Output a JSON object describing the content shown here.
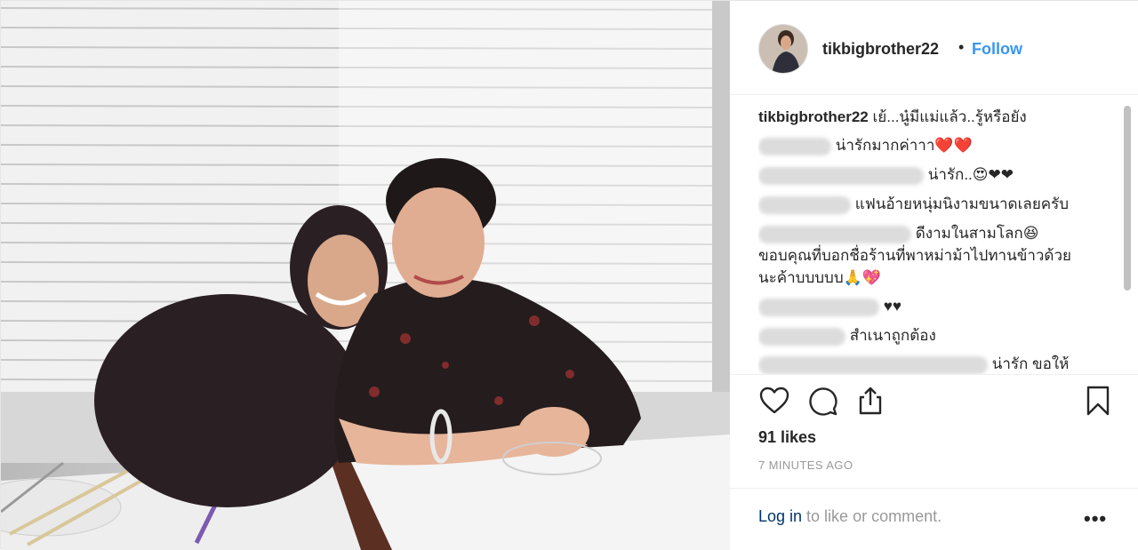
{
  "post": {
    "username": "tikbigbrother22",
    "separator": "•",
    "follow_label": "Follow",
    "caption": {
      "username": "tikbigbrother22",
      "text": "เย้...นู๋มีแม่แล้ว..รู้หรือยัง"
    },
    "comments": [
      {
        "text": "น่ารักมากค่าาา❤️❤️"
      },
      {
        "text": "น่ารัก..😍❤❤"
      },
      {
        "text": "แฟนอ้ายหนุ่มนิงามขนาดเลยครับ"
      },
      {
        "text": "ดีงามในสามโลก😆",
        "line2": "ขอบคุณที่บอกชื่อร้านที่พาหม่าม้าไปทานข้าวด้วย",
        "line3": "นะค้าบบบบบ🙏💖"
      },
      {
        "text": "♥♥"
      },
      {
        "text": "สำเนาถูกต้อง"
      },
      {
        "text": "น่ารัก ขอให้"
      }
    ],
    "likes": "91 likes",
    "timestamp": "7 MINUTES AGO",
    "footer": {
      "login_link": "Log in",
      "login_rest": " to like or comment.",
      "more": "•••"
    },
    "icons": {
      "like": "heart-icon",
      "comment": "comment-icon",
      "share": "share-icon",
      "save": "bookmark-icon",
      "more": "more-options-icon"
    },
    "colors": {
      "follow": "#3897f0",
      "text": "#262626",
      "muted": "#999999",
      "link": "#003569"
    }
  }
}
